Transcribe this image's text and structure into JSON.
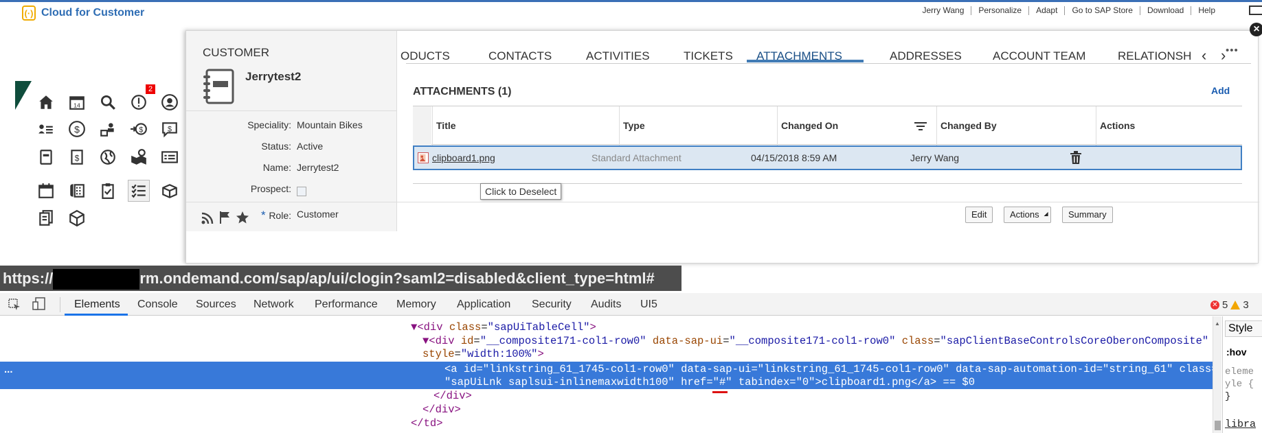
{
  "header": {
    "brand_name": "Cloud for Customer",
    "links": [
      "Jerry Wang",
      "Personalize",
      "Adapt",
      "Go to SAP Store",
      "Download",
      "Help"
    ]
  },
  "launcher": {
    "badge_count": "2",
    "icons": [
      "home-icon",
      "calendar-icon",
      "search-icon",
      "alert-icon",
      "user-circle-icon",
      "list-icon",
      "dollar-circle-icon",
      "org-icon",
      "dollar-transfer-icon",
      "message-dollar-icon",
      "folder-icon",
      "dollar-doc-icon",
      "globe-icon",
      "map-pin-icon",
      "address-card-icon",
      "calendar2-icon",
      "phone-grid-icon",
      "clipboard-icon",
      "checklist-icon",
      "box-icon",
      "documents-icon",
      "cube-icon"
    ]
  },
  "customer": {
    "label": "CUSTOMER",
    "name": "Jerrytest2",
    "fields": [
      {
        "label": "Speciality:",
        "value": "Mountain Bikes"
      },
      {
        "label": "Status:",
        "value": "Active"
      },
      {
        "label": "Name:",
        "value": "Jerrytest2"
      },
      {
        "label": "Prospect:",
        "value": ""
      },
      {
        "label": "Role:",
        "value": "Customer"
      }
    ]
  },
  "tabs": [
    "ODUCTS",
    "CONTACTS",
    "ACTIVITIES",
    "TICKETS",
    "ATTACHMENTS",
    "ADDRESSES",
    "ACCOUNT TEAM",
    "RELATIONSH"
  ],
  "active_tab": "ATTACHMENTS",
  "attachments": {
    "title": "ATTACHMENTS (1)",
    "add_label": "Add",
    "columns": [
      "Title",
      "Type",
      "Changed On",
      "Changed By",
      "Actions"
    ],
    "rows": [
      {
        "title": "clipboard1.png",
        "type": "Standard Attachment",
        "changed_on": "04/15/2018 8:59 AM",
        "changed_by": "Jerry Wang"
      }
    ],
    "tooltip": "Click to Deselect"
  },
  "footer_buttons": {
    "edit": "Edit",
    "actions": "Actions",
    "summary": "Summary"
  },
  "url_bar": {
    "prefix": "https://",
    "suffix": "rm.ondemand.com/sap/ap/ui/clogin?saml2=disabled&client_type=html#"
  },
  "devtools": {
    "tabs": [
      "Elements",
      "Console",
      "Sources",
      "Network",
      "Performance",
      "Memory",
      "Application",
      "Security",
      "Audits",
      "UI5"
    ],
    "errors": "5",
    "warnings": "3",
    "styles_tab": "Style",
    "styles_hov": ":hov",
    "styles_el1": "eleme",
    "styles_el2": "yle {",
    "styles_el3": "}",
    "styles_lib": "libra",
    "code": {
      "l1_tag": "<div ",
      "l1_attr": "class",
      "l1_val": "\"sapUiTableCell\"",
      "l2_attr1": "id",
      "l2_val1": "\"__composite171-col1-row0\"",
      "l2_attr2": "data-sap-ui",
      "l2_val2": "\"__composite171-col1-row0\"",
      "l2_attr3": "class",
      "l2_val3": "\"sapClientBaseControlsCoreOberonComposite\"",
      "l3_attr": "style",
      "l3_val": "\"width:100%\"",
      "sel1": "<a id=\"linkstring_61_1745-col1-row0\" data-sap-ui=\"linkstring_61_1745-col1-row0\" data-sap-automation-id=\"string_61\" class=",
      "sel2": "\"sapUiLnk saplsui-inlinemaxwidth100\" href=\"#\" tabindex=\"0\">clipboard1.png</a> == $0",
      "close_div": "</div>",
      "close_td": "</td>"
    }
  }
}
